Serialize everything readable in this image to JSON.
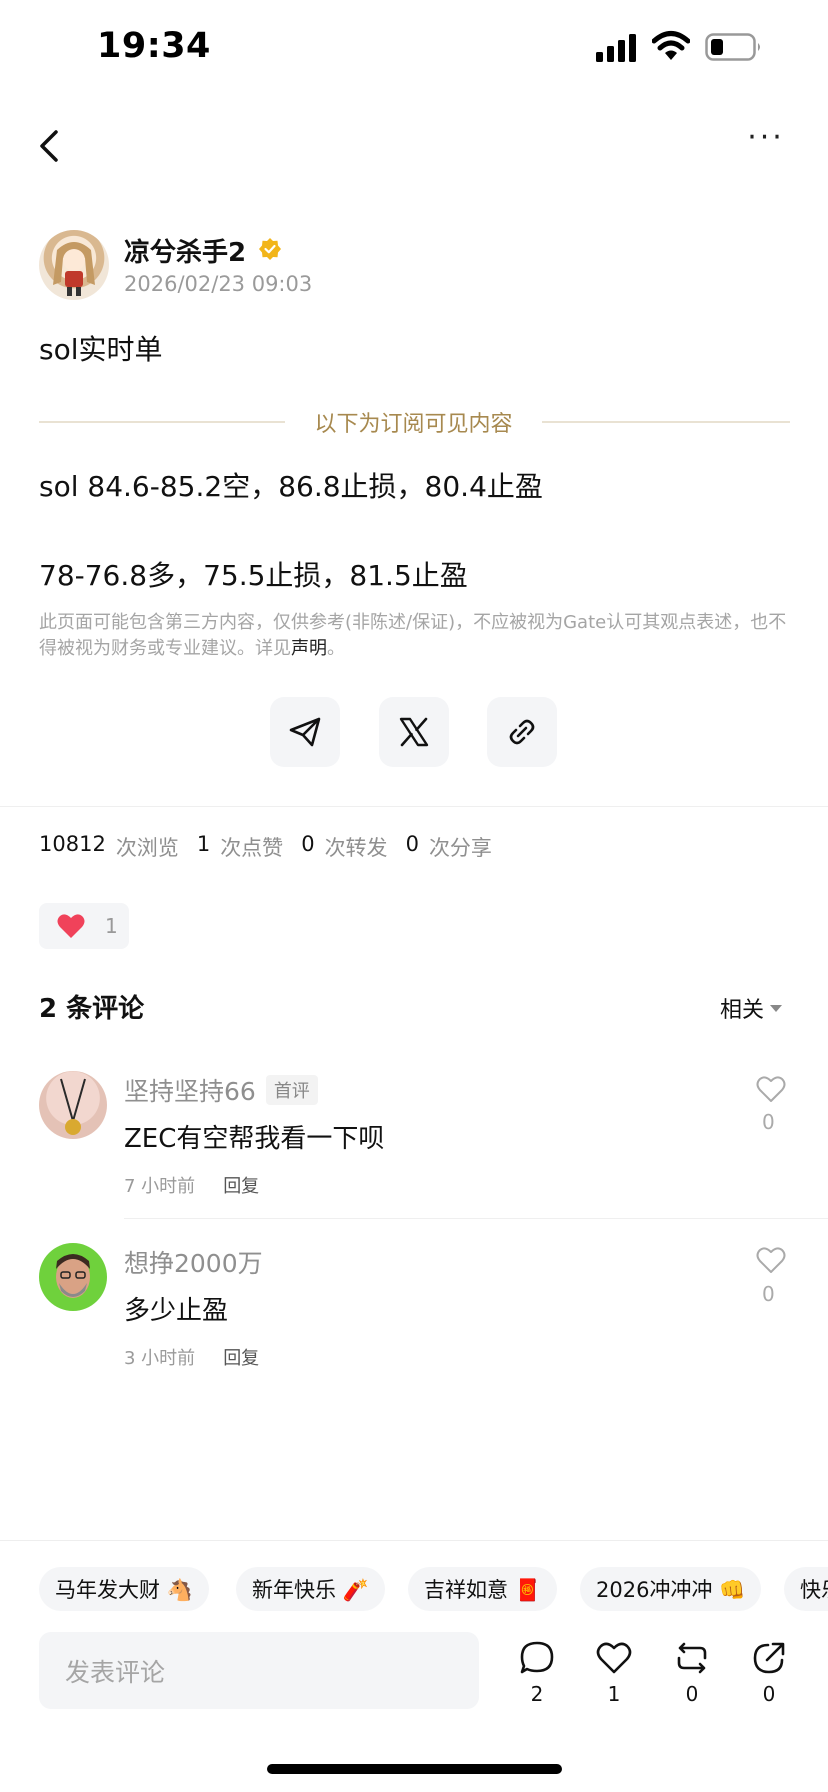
{
  "status_bar": {
    "time": "19:34"
  },
  "post": {
    "author": "凉兮杀手2",
    "time": "2026/02/23 09:03",
    "title": "sol实时单",
    "subscription_label": "以下为订阅可见内容",
    "line1": "sol 84.6-85.2空，86.8止损，80.4止盈",
    "line2": "78-76.8多，75.5止损，81.5止盈",
    "disclaimer": "此页面可能包含第三方内容，仅供参考(非陈述/保证)，不应被视为Gate认可其观点表述，也不得被视为财务或专业建议。详见",
    "disclaimer_link": "声明",
    "disclaimer_end": "。"
  },
  "stats": {
    "views": "10812",
    "views_label": "次浏览",
    "likes": "1",
    "likes_label": "次点赞",
    "reposts": "0",
    "reposts_label": "次转发",
    "shares": "0",
    "shares_label": "次分享"
  },
  "reaction": {
    "heart_count": "1"
  },
  "comments_header": {
    "count_label": "2 条评论",
    "sort_label": "相关"
  },
  "comments": [
    {
      "name": "坚持坚持66",
      "badge": "首评",
      "text": "ZEC有空帮我看一下呗",
      "time": "7 小时前",
      "reply": "回复",
      "likes": "0"
    },
    {
      "name": "想挣2000万",
      "badge": "",
      "text": "多少止盈",
      "time": "3 小时前",
      "reply": "回复",
      "likes": "0"
    }
  ],
  "tags": [
    "马年发大财 🐴",
    "新年快乐 🧨",
    "吉祥如意 🧧",
    "2026冲冲冲 👊",
    "快乐"
  ],
  "bottom_bar": {
    "input_placeholder": "发表评论",
    "comment_count": "2",
    "like_count": "1",
    "repost_count": "0",
    "share_count": "0"
  },
  "colors": {
    "gold": "#a7894f",
    "heart": "#f0425a",
    "verified": "#f2b51a"
  }
}
